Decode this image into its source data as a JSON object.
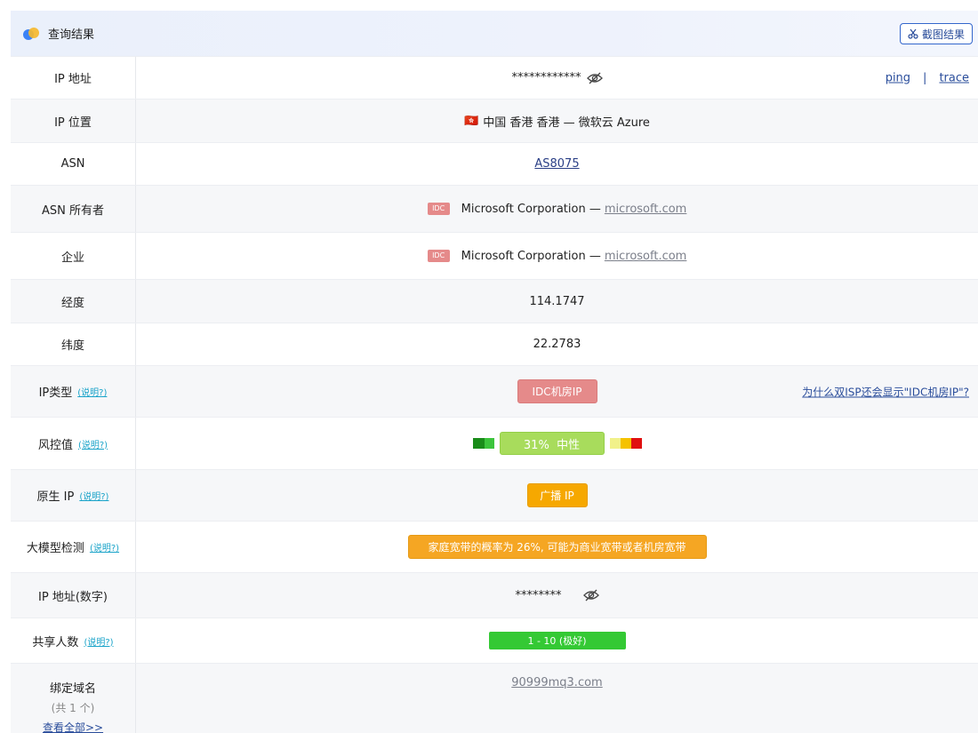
{
  "header": {
    "title": "查询结果",
    "screenshot_btn": "截图结果"
  },
  "rows": {
    "ip": {
      "label": "IP 地址",
      "value": "************",
      "ping": "ping",
      "sep": "|",
      "trace": "trace"
    },
    "location": {
      "label": "IP 位置",
      "flag": "🇭🇰",
      "value": "中国 香港 香港 — 微软云 Azure"
    },
    "asn": {
      "label": "ASN",
      "value": "AS8075"
    },
    "asn_owner": {
      "label": "ASN 所有者",
      "tag": "IDC",
      "name": "Microsoft Corporation —",
      "domain": "microsoft.com"
    },
    "company": {
      "label": "企业",
      "tag": "IDC",
      "name": "Microsoft Corporation —",
      "domain": "microsoft.com"
    },
    "longitude": {
      "label": "经度",
      "value": "114.1747"
    },
    "latitude": {
      "label": "纬度",
      "value": "22.2783"
    },
    "ip_type": {
      "label": "IP类型",
      "help": "(说明?)",
      "badge": "IDC机房IP",
      "why": "为什么双ISP还会显示\"IDC机房IP\"?"
    },
    "risk": {
      "label": "风控值",
      "help": "(说明?)",
      "badge": "31%  中性",
      "percent": 31
    },
    "native": {
      "label": "原生 IP",
      "help": "(说明?)",
      "badge": "广播 IP"
    },
    "llm": {
      "label": "大模型检测",
      "help": "(说明?)",
      "badge": "家庭宽带的概率为 26%, 可能为商业宽带或者机房宽带"
    },
    "ip_numeric": {
      "label": "IP 地址(数字)",
      "value": "********"
    },
    "share": {
      "label": "共享人数",
      "help": "(说明?)",
      "badge": "1 - 10 (极好)"
    },
    "domains": {
      "label": "绑定域名",
      "count": "(共 1 个)",
      "view_all": "查看全部>>",
      "value": "90999mq3.com"
    }
  },
  "colors": {
    "idc_red": "#e58a8a",
    "risk_green": "#a8dc5c",
    "native_orange": "#f6a800",
    "llm_orange": "#f5a623",
    "share_green": "#34c934",
    "link_blue": "#2a4d9b"
  }
}
